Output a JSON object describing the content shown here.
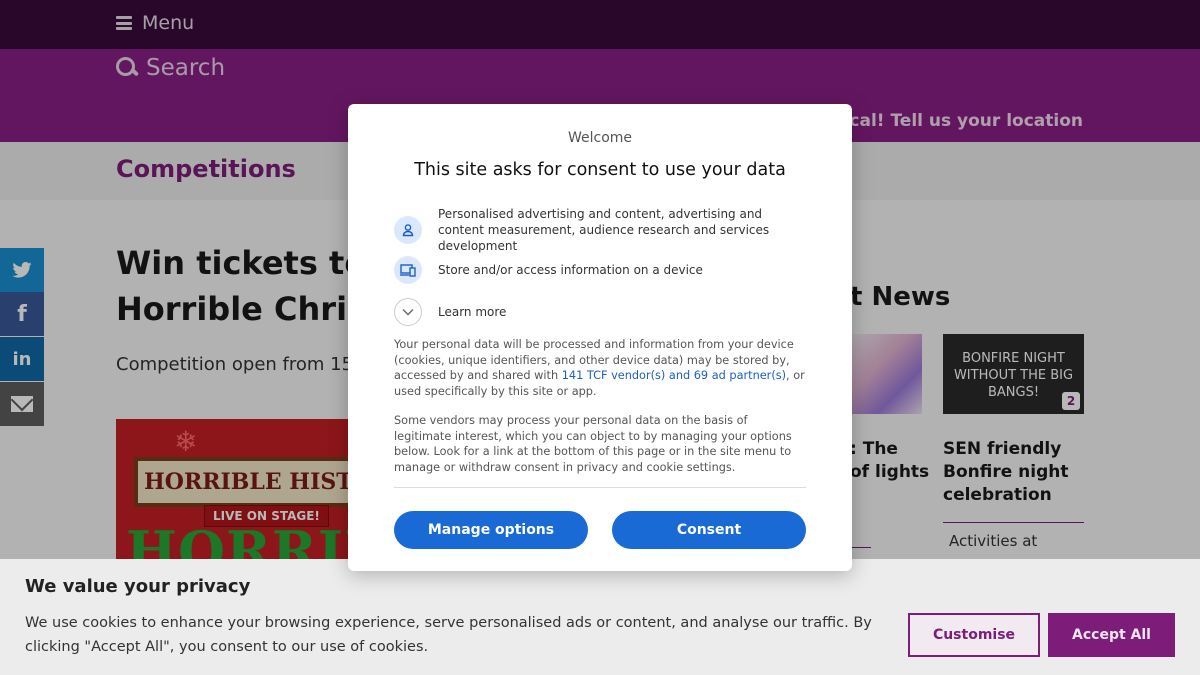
{
  "header": {
    "menu_label": "Menu",
    "search_label": "Search",
    "location_prompt": "ocal! Tell us your location"
  },
  "section": {
    "title": "Competitions"
  },
  "share": {
    "twitter": "twitter-icon",
    "facebook": "facebook-icon",
    "linkedin": "linkedin-icon",
    "email": "email-icon"
  },
  "article": {
    "headline_line1": "Win tickets to",
    "headline_line2": "Horrible Chris",
    "competition_open": "Competition open from 15",
    "promo": {
      "sign_text": "HORRIBLE HISTORIES",
      "stage_text": "LIVE ON STAGE!",
      "big_text": "HORRIBLE"
    }
  },
  "latest_news": {
    "heading": "t News",
    "thumb2_text": "BONFIRE NIGHT WITHOUT THE BIG BANGS!",
    "thumb2_badge": "2",
    "item1_line1": ": The",
    "item1_line2": "of lights",
    "item2": "SEN friendly Bonfire night celebration",
    "item3": "Activities at"
  },
  "consent_modal": {
    "welcome": "Welcome",
    "title": "This site asks for consent to use your data",
    "purposes": [
      {
        "icon": "person-icon",
        "text": "Personalised advertising and content, advertising and content measurement, audience research and services development"
      },
      {
        "icon": "devices-icon",
        "text": "Store and/or access information on a device"
      },
      {
        "icon": "chevron-down-icon",
        "text": "Learn more"
      }
    ],
    "para1_before": "Your personal data will be processed and information from your device (cookies, unique identifiers, and other device data) may be stored by, accessed by and shared with ",
    "para1_link": "141 TCF vendor(s) and 69 ad partner(s)",
    "para1_after": ", or used specifically by this site or app.",
    "para2": "Some vendors may process your personal data on the basis of legitimate interest, which you can object to by managing your options below. Look for a link at the bottom of this page or in the site menu to manage or withdraw consent in privacy and cookie settings.",
    "manage_label": "Manage options",
    "consent_label": "Consent"
  },
  "privacy_banner": {
    "title": "We value your privacy",
    "text": "We use cookies to enhance your browsing experience, serve personalised ads or content, and analyse our traffic. By clicking \"Accept All\", you consent to our use of cookies.",
    "customise_label": "Customise",
    "accept_label": "Accept All"
  }
}
